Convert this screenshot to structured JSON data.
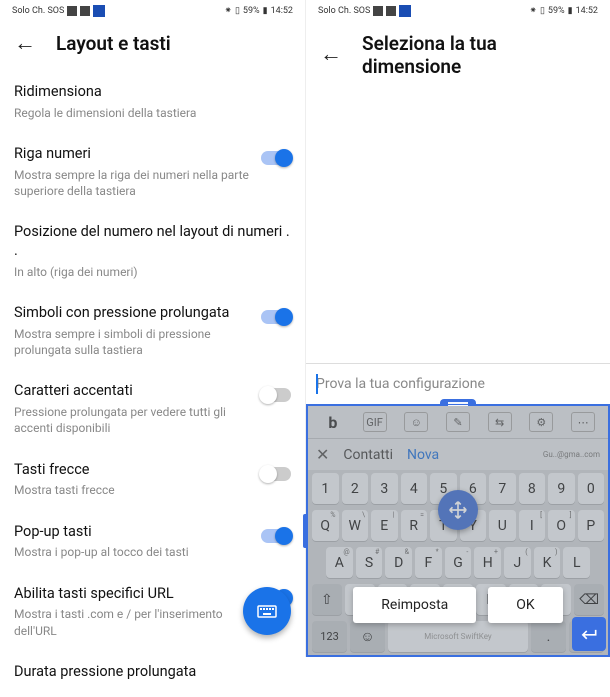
{
  "statusbar": {
    "carrier": "Solo Ch. SOS",
    "battery": "59%",
    "time": "14:52"
  },
  "left": {
    "title": "Layout e tasti",
    "items": [
      {
        "label": "Ridimensiona",
        "desc": "Regola le dimensioni della tastiera",
        "toggle": null
      },
      {
        "label": "Riga numeri",
        "desc": "Mostra sempre la riga dei numeri nella parte superiore della tastiera",
        "toggle": true
      },
      {
        "label": "Posizione del numero nel layout di numeri . .",
        "desc": "In alto (riga dei numeri)",
        "toggle": null
      },
      {
        "label": "Simboli con pressione prolungata",
        "desc": "Mostra sempre i simboli di pressione prolungata sulla tastiera",
        "toggle": true
      },
      {
        "label": "Caratteri accentati",
        "desc": "Pressione prolungata per vedere tutti gli accenti disponibili",
        "toggle": false
      },
      {
        "label": "Tasti frecce",
        "desc": "Mostra tasti frecce",
        "toggle": false
      },
      {
        "label": "Pop-up tasti",
        "desc": "Mostra i pop-up al tocco dei tasti",
        "toggle": true
      },
      {
        "label": "Abilita tasti specifici URL",
        "desc": "Mostra i tasti .com e / per l'inserimento dell'URL",
        "toggle": true
      },
      {
        "label": "Durata pressione prolungata",
        "desc": "",
        "toggle": null
      }
    ]
  },
  "right": {
    "title": "Seleziona la tua dimensione",
    "try_placeholder": "Prova la tua configurazione",
    "toolbar": {
      "gif": "GIF"
    },
    "suggestions": {
      "close": "✕",
      "s1": "Contatti",
      "s2": "Nova",
      "mini": "Gu..@gma..com"
    },
    "row_num": [
      "1",
      "2",
      "3",
      "4",
      "5",
      "6",
      "7",
      "8",
      "9",
      "0"
    ],
    "row1": [
      "Q",
      "W",
      "E",
      "R",
      "T",
      "Y",
      "U",
      "I",
      "O",
      "P"
    ],
    "row1_sup": [
      "%",
      "\\",
      "|",
      "=",
      "",
      "",
      "",
      "[",
      "]",
      ""
    ],
    "row2": [
      "A",
      "S",
      "D",
      "F",
      "G",
      "H",
      "J",
      "K",
      "L"
    ],
    "row2_sup": [
      "@",
      "#",
      "&",
      "*",
      "-",
      "+",
      "(",
      ")",
      ""
    ],
    "bottom": {
      "num": "123",
      "emoji": "☺"
    },
    "buttons": {
      "reset": "Reimposta",
      "ok": "OK"
    }
  }
}
